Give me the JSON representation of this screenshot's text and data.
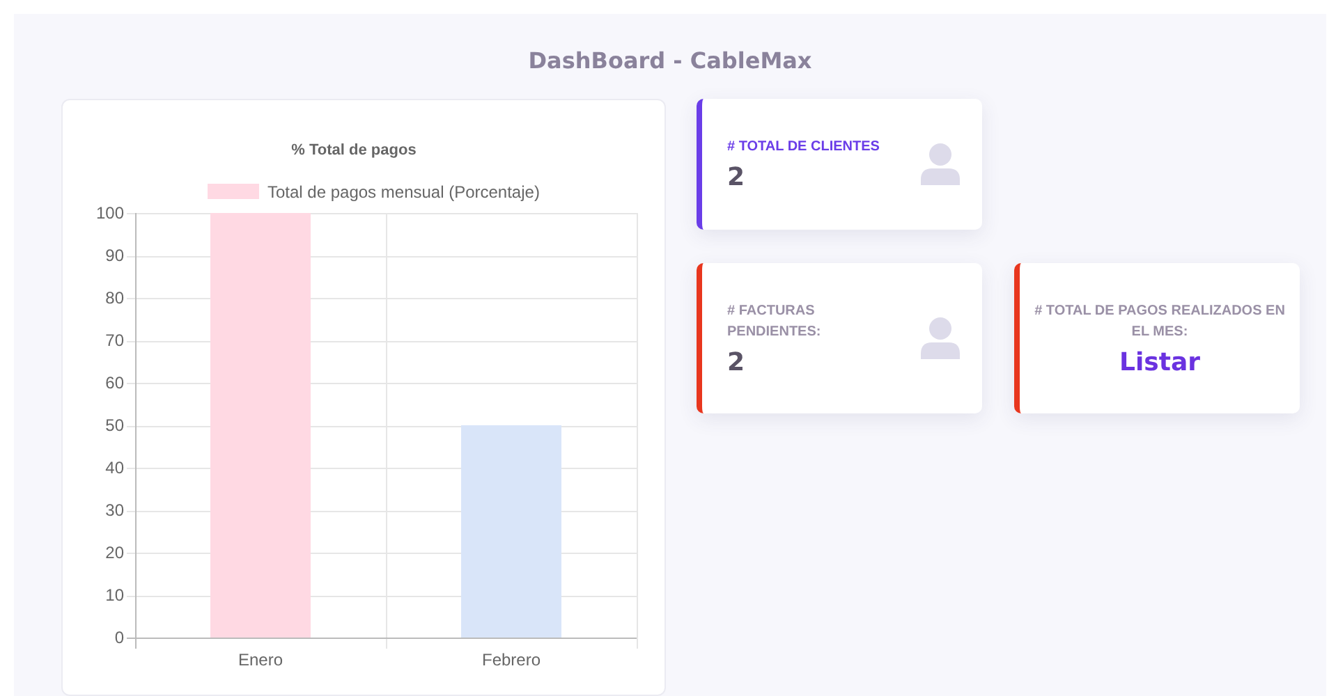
{
  "page_title": "DashBoard - CableMax",
  "chart_panel": {
    "chart_data": {
      "type": "bar",
      "title": "% Total de pagos",
      "categories": [
        "Enero",
        "Febrero"
      ],
      "series": [
        {
          "name": "Total de pagos mensual (Porcentaje)",
          "color": "#ffd9e3",
          "values": [
            100,
            null
          ]
        },
        {
          "color": "#d9e5f9",
          "values": [
            null,
            50
          ]
        }
      ],
      "stacked": true,
      "grid": true,
      "ylim": [
        0,
        100
      ],
      "yticks": [
        0,
        10,
        20,
        30,
        40,
        50,
        60,
        70,
        80,
        90,
        100
      ]
    }
  },
  "stat_rows": [
    [
      {
        "kind": "count",
        "label": "# TOTAL DE CLIENTES",
        "value": "2",
        "color": "#6a3de8"
      }
    ],
    [
      {
        "kind": "count",
        "label": "# FACTURAS PENDIENTES:",
        "value": "2",
        "color": "#e8361e"
      },
      {
        "kind": "link",
        "label": "# TOTAL DE PAGOS REALIZADOS EN EL MES:",
        "value": "Listar",
        "color": "#e8361e"
      }
    ]
  ]
}
